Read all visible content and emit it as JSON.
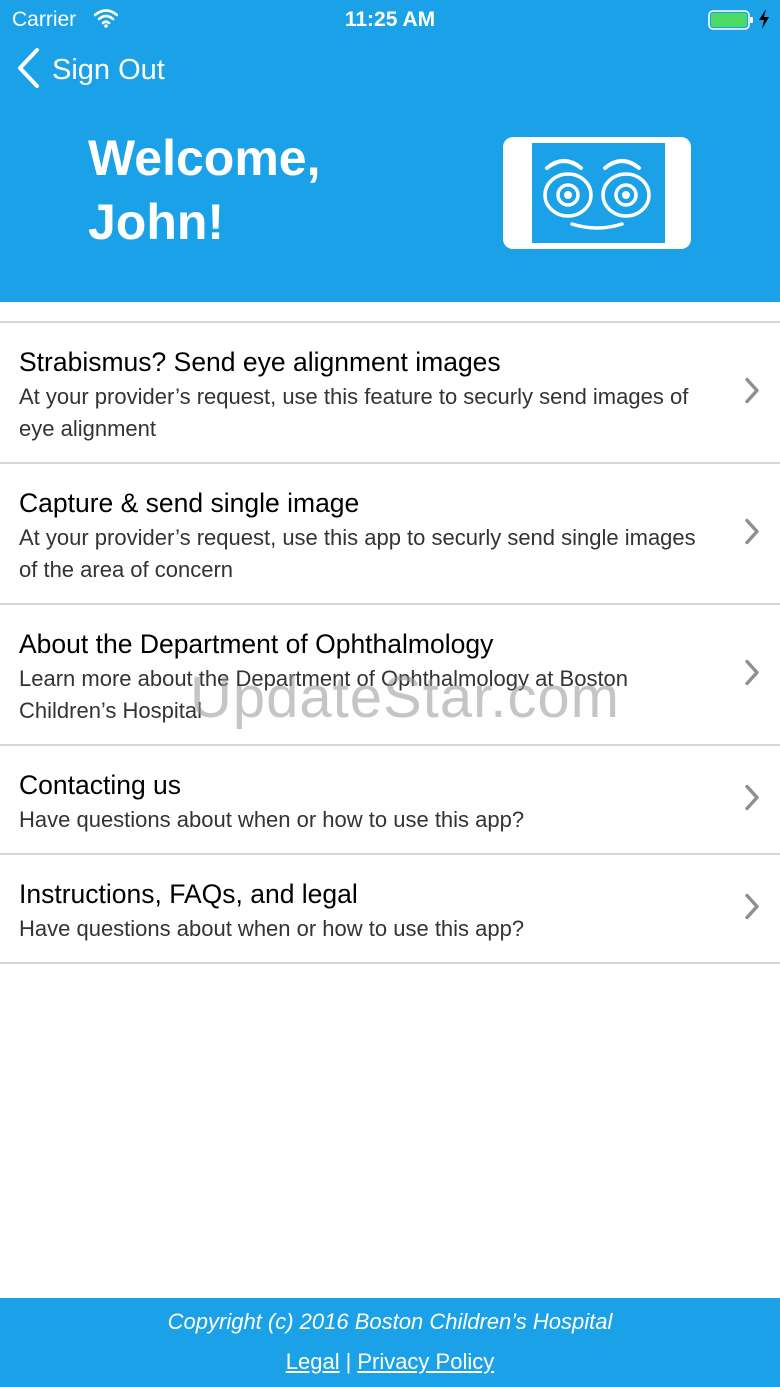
{
  "status_bar": {
    "carrier": "Carrier",
    "time": "11:25 AM",
    "battery_color": "#4cd964"
  },
  "header": {
    "back_label": "Sign Out",
    "welcome_line1": "Welcome,",
    "welcome_line2": "John!",
    "background_color": "#1ba1e8",
    "logo_icon": "tablet-face-icon"
  },
  "menu": {
    "items": [
      {
        "title": "Strabismus? Send eye alignment images",
        "description": "At your provider’s request, use this feature to securly send images of eye alignment"
      },
      {
        "title": "Capture & send single image",
        "description": "At your provider’s request, use this app to securly send single images of the area of concern"
      },
      {
        "title": "About the Department of Ophthalmology",
        "description": "Learn more about the Department of Ophthalmology at Boston Children’s Hospital"
      },
      {
        "title": "Contacting us",
        "description": "Have questions about when or how to use this app?"
      },
      {
        "title": "Instructions, FAQs, and legal",
        "description": "Have questions about when or how to use this app?"
      }
    ]
  },
  "watermark": "UpdateStar.com",
  "footer": {
    "copyright": "Copyright (c) 2016 Boston Children’s Hospital",
    "legal_link": "Legal",
    "separator": "|",
    "privacy_link": "Privacy Policy"
  }
}
